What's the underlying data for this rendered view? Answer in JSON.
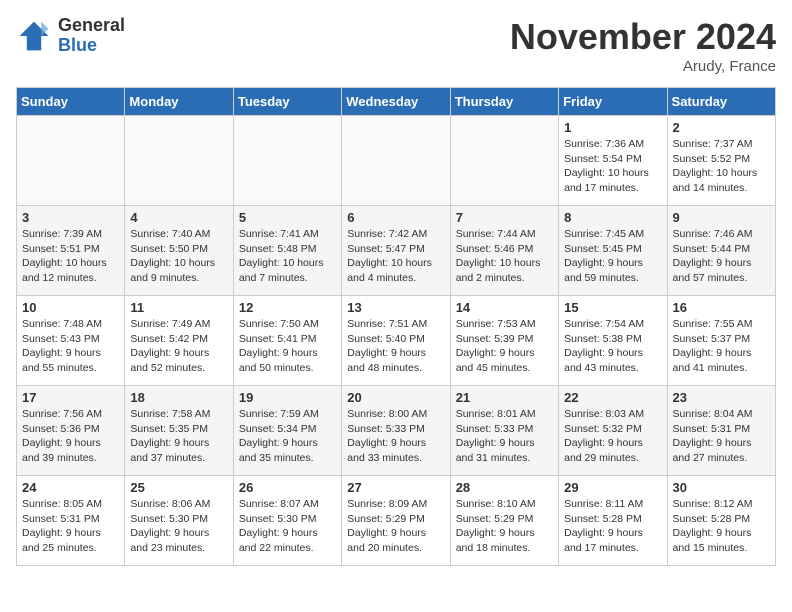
{
  "logo": {
    "general": "General",
    "blue": "Blue"
  },
  "title": "November 2024",
  "location": "Arudy, France",
  "headers": [
    "Sunday",
    "Monday",
    "Tuesday",
    "Wednesday",
    "Thursday",
    "Friday",
    "Saturday"
  ],
  "weeks": [
    [
      {
        "day": "",
        "info": ""
      },
      {
        "day": "",
        "info": ""
      },
      {
        "day": "",
        "info": ""
      },
      {
        "day": "",
        "info": ""
      },
      {
        "day": "",
        "info": ""
      },
      {
        "day": "1",
        "info": "Sunrise: 7:36 AM\nSunset: 5:54 PM\nDaylight: 10 hours and 17 minutes."
      },
      {
        "day": "2",
        "info": "Sunrise: 7:37 AM\nSunset: 5:52 PM\nDaylight: 10 hours and 14 minutes."
      }
    ],
    [
      {
        "day": "3",
        "info": "Sunrise: 7:39 AM\nSunset: 5:51 PM\nDaylight: 10 hours and 12 minutes."
      },
      {
        "day": "4",
        "info": "Sunrise: 7:40 AM\nSunset: 5:50 PM\nDaylight: 10 hours and 9 minutes."
      },
      {
        "day": "5",
        "info": "Sunrise: 7:41 AM\nSunset: 5:48 PM\nDaylight: 10 hours and 7 minutes."
      },
      {
        "day": "6",
        "info": "Sunrise: 7:42 AM\nSunset: 5:47 PM\nDaylight: 10 hours and 4 minutes."
      },
      {
        "day": "7",
        "info": "Sunrise: 7:44 AM\nSunset: 5:46 PM\nDaylight: 10 hours and 2 minutes."
      },
      {
        "day": "8",
        "info": "Sunrise: 7:45 AM\nSunset: 5:45 PM\nDaylight: 9 hours and 59 minutes."
      },
      {
        "day": "9",
        "info": "Sunrise: 7:46 AM\nSunset: 5:44 PM\nDaylight: 9 hours and 57 minutes."
      }
    ],
    [
      {
        "day": "10",
        "info": "Sunrise: 7:48 AM\nSunset: 5:43 PM\nDaylight: 9 hours and 55 minutes."
      },
      {
        "day": "11",
        "info": "Sunrise: 7:49 AM\nSunset: 5:42 PM\nDaylight: 9 hours and 52 minutes."
      },
      {
        "day": "12",
        "info": "Sunrise: 7:50 AM\nSunset: 5:41 PM\nDaylight: 9 hours and 50 minutes."
      },
      {
        "day": "13",
        "info": "Sunrise: 7:51 AM\nSunset: 5:40 PM\nDaylight: 9 hours and 48 minutes."
      },
      {
        "day": "14",
        "info": "Sunrise: 7:53 AM\nSunset: 5:39 PM\nDaylight: 9 hours and 45 minutes."
      },
      {
        "day": "15",
        "info": "Sunrise: 7:54 AM\nSunset: 5:38 PM\nDaylight: 9 hours and 43 minutes."
      },
      {
        "day": "16",
        "info": "Sunrise: 7:55 AM\nSunset: 5:37 PM\nDaylight: 9 hours and 41 minutes."
      }
    ],
    [
      {
        "day": "17",
        "info": "Sunrise: 7:56 AM\nSunset: 5:36 PM\nDaylight: 9 hours and 39 minutes."
      },
      {
        "day": "18",
        "info": "Sunrise: 7:58 AM\nSunset: 5:35 PM\nDaylight: 9 hours and 37 minutes."
      },
      {
        "day": "19",
        "info": "Sunrise: 7:59 AM\nSunset: 5:34 PM\nDaylight: 9 hours and 35 minutes."
      },
      {
        "day": "20",
        "info": "Sunrise: 8:00 AM\nSunset: 5:33 PM\nDaylight: 9 hours and 33 minutes."
      },
      {
        "day": "21",
        "info": "Sunrise: 8:01 AM\nSunset: 5:33 PM\nDaylight: 9 hours and 31 minutes."
      },
      {
        "day": "22",
        "info": "Sunrise: 8:03 AM\nSunset: 5:32 PM\nDaylight: 9 hours and 29 minutes."
      },
      {
        "day": "23",
        "info": "Sunrise: 8:04 AM\nSunset: 5:31 PM\nDaylight: 9 hours and 27 minutes."
      }
    ],
    [
      {
        "day": "24",
        "info": "Sunrise: 8:05 AM\nSunset: 5:31 PM\nDaylight: 9 hours and 25 minutes."
      },
      {
        "day": "25",
        "info": "Sunrise: 8:06 AM\nSunset: 5:30 PM\nDaylight: 9 hours and 23 minutes."
      },
      {
        "day": "26",
        "info": "Sunrise: 8:07 AM\nSunset: 5:30 PM\nDaylight: 9 hours and 22 minutes."
      },
      {
        "day": "27",
        "info": "Sunrise: 8:09 AM\nSunset: 5:29 PM\nDaylight: 9 hours and 20 minutes."
      },
      {
        "day": "28",
        "info": "Sunrise: 8:10 AM\nSunset: 5:29 PM\nDaylight: 9 hours and 18 minutes."
      },
      {
        "day": "29",
        "info": "Sunrise: 8:11 AM\nSunset: 5:28 PM\nDaylight: 9 hours and 17 minutes."
      },
      {
        "day": "30",
        "info": "Sunrise: 8:12 AM\nSunset: 5:28 PM\nDaylight: 9 hours and 15 minutes."
      }
    ]
  ]
}
